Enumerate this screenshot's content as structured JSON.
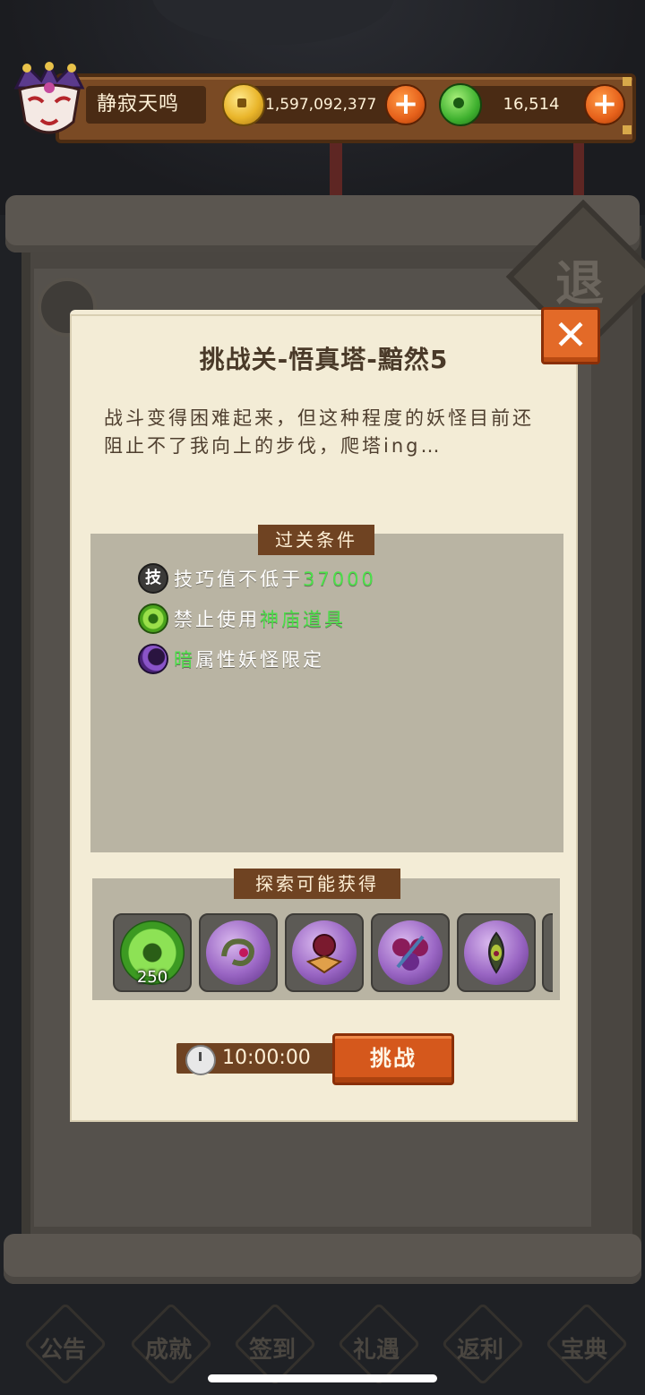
{
  "hud": {
    "player_name": "静寂天鸣",
    "gold_amount": "1,597,092,377",
    "jade_amount": "16,514",
    "add_symbol": "+"
  },
  "background": {
    "exit_label": "退",
    "nav_items": [
      "公告",
      "成就",
      "签到",
      "礼遇",
      "返利",
      "宝典"
    ]
  },
  "dialog": {
    "title": "挑战关-悟真塔-黯然5",
    "description": "战斗变得困难起来，但这种程度的妖怪目前还阻止不了我向上的步伐，爬塔ing…",
    "close_symbol": "✕",
    "conditions_header": "过关条件",
    "conditions": [
      {
        "icon": "skill-badge-icon",
        "badge": "技",
        "prefix": "技巧值不低于",
        "highlight": "37000",
        "suffix": ""
      },
      {
        "icon": "green-spiral-icon",
        "badge": "",
        "prefix": "禁止使用",
        "highlight": "神庙道具",
        "suffix": ""
      },
      {
        "icon": "dark-moon-icon",
        "badge": "",
        "prefix": "",
        "highlight": "暗",
        "suffix": "属性妖怪限定"
      }
    ],
    "rewards_header": "探索可能获得",
    "rewards": [
      {
        "icon": "jade-coin-icon",
        "count": "250"
      },
      {
        "icon": "purple-orb-serpent-icon",
        "count": ""
      },
      {
        "icon": "purple-orb-mask-icon",
        "count": ""
      },
      {
        "icon": "purple-orb-mandala-icon",
        "count": ""
      },
      {
        "icon": "purple-orb-feather-icon",
        "count": ""
      }
    ],
    "timer": "10:00:00",
    "challenge_label": "挑战"
  },
  "colors": {
    "highlight_green": "#4ce04a",
    "button_orange": "#d5581c",
    "panel_brown": "#6f4322",
    "parchment": "#f3ecd6"
  }
}
